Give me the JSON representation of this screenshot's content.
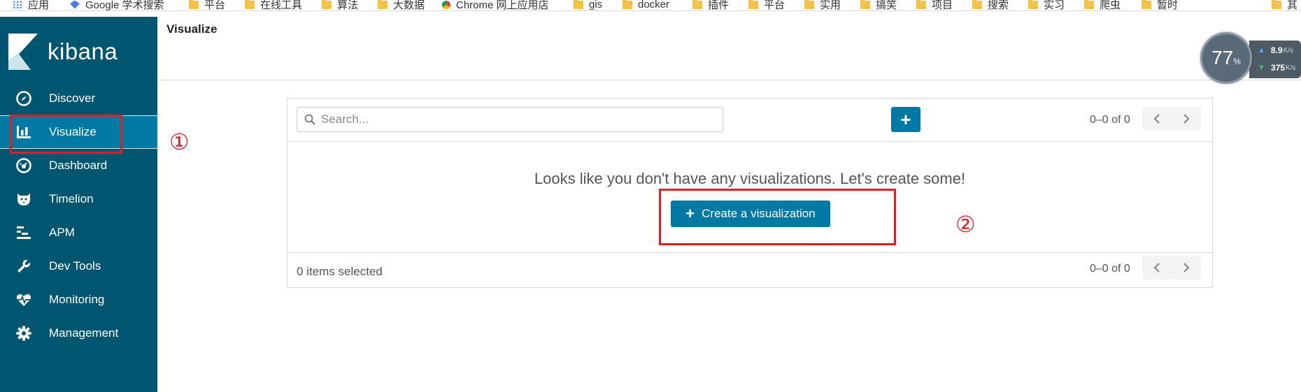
{
  "bookmarks": [
    {
      "label": "应用",
      "icon": "apps-grid-icon"
    },
    {
      "label": "Google 学术搜索",
      "icon": "google-scholar-icon"
    },
    {
      "label": "平台",
      "icon": "folder-icon"
    },
    {
      "label": "在线工具",
      "icon": "folder-icon"
    },
    {
      "label": "算法",
      "icon": "folder-icon"
    },
    {
      "label": "大数据",
      "icon": "folder-icon"
    },
    {
      "label": "Chrome 网上应用店",
      "icon": "chrome-icon"
    },
    {
      "label": "gis",
      "icon": "folder-icon"
    },
    {
      "label": "docker",
      "icon": "folder-icon"
    },
    {
      "label": "插件",
      "icon": "folder-icon"
    },
    {
      "label": "平台",
      "icon": "folder-icon"
    },
    {
      "label": "实用",
      "icon": "folder-icon"
    },
    {
      "label": "搞笑",
      "icon": "folder-icon"
    },
    {
      "label": "项目",
      "icon": "folder-icon"
    },
    {
      "label": "搜索",
      "icon": "folder-icon"
    },
    {
      "label": "实习",
      "icon": "folder-icon"
    },
    {
      "label": "爬虫",
      "icon": "folder-icon"
    },
    {
      "label": "暂时",
      "icon": "folder-icon"
    },
    {
      "label": "其",
      "icon": "folder-icon"
    }
  ],
  "app": {
    "name": "kibana",
    "brand_color": "#005571",
    "accent_color": "#0079a5"
  },
  "nav": [
    {
      "label": "Discover",
      "icon": "compass-icon"
    },
    {
      "label": "Visualize",
      "icon": "bar-chart-icon",
      "active": true
    },
    {
      "label": "Dashboard",
      "icon": "dashboard-icon"
    },
    {
      "label": "Timelion",
      "icon": "timelion-icon"
    },
    {
      "label": "APM",
      "icon": "apm-icon"
    },
    {
      "label": "Dev Tools",
      "icon": "wrench-icon"
    },
    {
      "label": "Monitoring",
      "icon": "heartbeat-icon"
    },
    {
      "label": "Management",
      "icon": "gear-icon"
    }
  ],
  "page": {
    "title": "Visualize"
  },
  "annotations": {
    "step1": "①",
    "step2": "②",
    "highlight_color": "#e51c23"
  },
  "toolbar": {
    "search_placeholder": "Search...",
    "search_value": "",
    "add_label": "+",
    "pager": "0–0 of 0"
  },
  "empty_state": {
    "message": "Looks like you don't have any visualizations. Let's create some!",
    "create_plus": "+",
    "create_label": "Create a visualization"
  },
  "footer": {
    "selected": "0 items selected",
    "pager": "0–0 of 0"
  },
  "network": {
    "percent": "77",
    "percent_unit": "%",
    "upload": "8.9",
    "upload_unit": "K/s",
    "download": "375",
    "download_unit": "K/s"
  }
}
